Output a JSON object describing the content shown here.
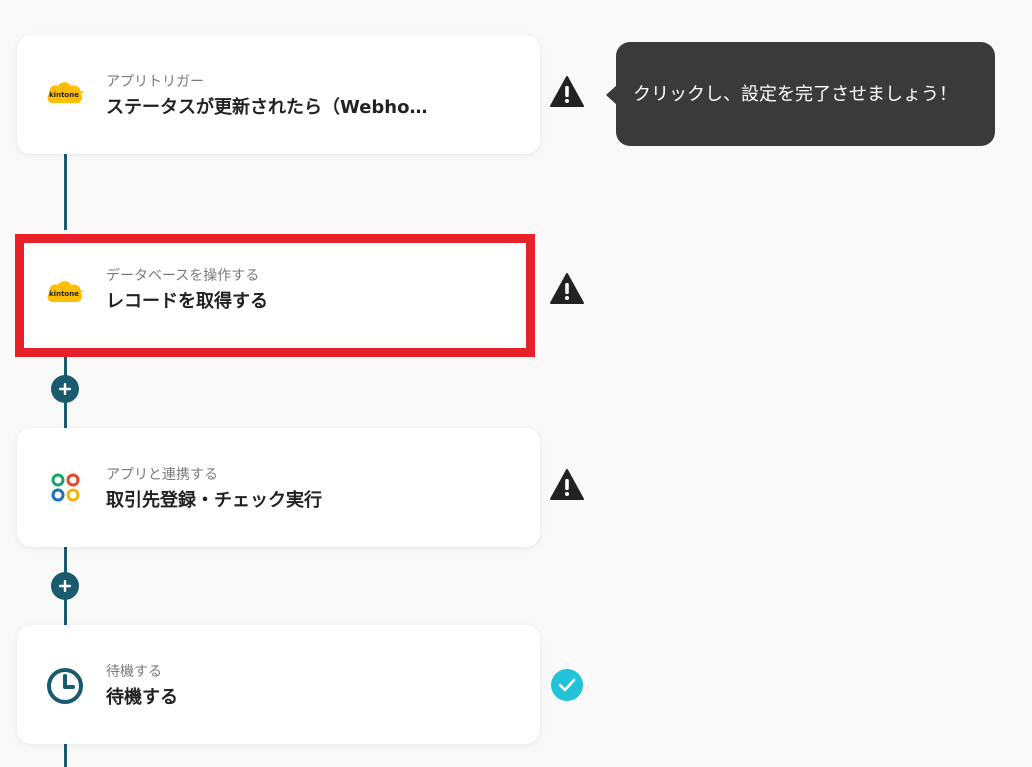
{
  "steps": [
    {
      "label": "アプリトリガー",
      "title": "ステータスが更新されたら（Webho…",
      "app_icon": "kintone-icon",
      "status": "warning-icon"
    },
    {
      "label": "データベースを操作する",
      "title": "レコードを取得する",
      "app_icon": "kintone-icon",
      "status": "warning-icon"
    },
    {
      "label": "アプリと連携する",
      "title": "取引先登録・チェック実行",
      "app_icon": "app-integration-icon",
      "status": "warning-icon"
    },
    {
      "label": "待機する",
      "title": "待機する",
      "app_icon": "clock-icon",
      "status": "check-icon"
    }
  ],
  "kintone_logo_text": "kintone",
  "tooltip": {
    "text": "クリックし、設定を完了させましょう！"
  },
  "colors": {
    "connector": "#1a5a6e",
    "highlight": "#e8202a",
    "kintone": "#ffbe00",
    "check": "#22c3d6",
    "tooltip_bg": "#3a3a3a"
  }
}
